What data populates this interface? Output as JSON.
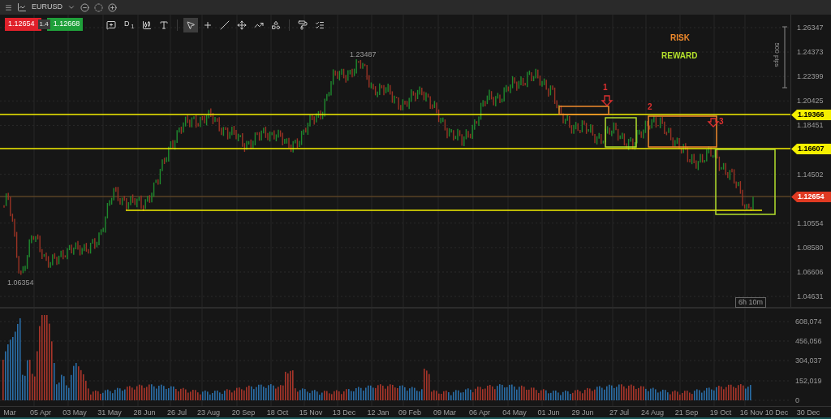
{
  "window": {
    "title": "EURUSD"
  },
  "quote": {
    "bid": "1.12654",
    "spread": "1.4",
    "ask": "1.12668"
  },
  "toolbar": {
    "tools": [
      {
        "kind": "comment",
        "selected": false
      },
      {
        "kind": "timeframe",
        "label": "D",
        "sub": "1",
        "selected": false
      },
      {
        "kind": "bars",
        "selected": false
      },
      {
        "kind": "text",
        "selected": false
      },
      {
        "kind": "pointer",
        "selected": true
      },
      {
        "kind": "crosshair",
        "selected": false
      },
      {
        "kind": "line",
        "selected": false
      },
      {
        "kind": "star",
        "selected": false
      },
      {
        "kind": "polyline",
        "selected": false
      },
      {
        "kind": "shapes",
        "selected": false
      },
      {
        "kind": "paint",
        "selected": false
      },
      {
        "kind": "list",
        "selected": false
      }
    ]
  },
  "legend": [
    {
      "text": "RISK",
      "color": "#f08a2c"
    },
    {
      "text": "REWARD",
      "color": "#b4e02c"
    }
  ],
  "markers": [
    "1",
    "2",
    "3"
  ],
  "high_label": "1.23487",
  "low_label": "1.06354",
  "range_label": "500 pips",
  "countdown": "6h 10m",
  "price_axis": {
    "labels": [
      "1.26347",
      "1.24373",
      "1.22399",
      "1.20425",
      "1.18451",
      "1.14502",
      "1.10554",
      "1.08580",
      "1.06606",
      "1.04631"
    ],
    "price_tags": [
      {
        "text": "1.19366",
        "kind": "line",
        "color": "#f5f000"
      },
      {
        "text": "1.16607",
        "kind": "line",
        "color": "#f5f000"
      },
      {
        "text": "1.12654",
        "kind": "current",
        "color": "#e03a22"
      }
    ]
  },
  "volume_axis": {
    "labels": [
      "608,074",
      "456,056",
      "304,037",
      "152,019",
      "0"
    ]
  },
  "time_axis": {
    "labels": [
      "Mar",
      "05 Apr",
      "03 May",
      "31 May",
      "28 Jun",
      "26 Jul",
      "23 Aug",
      "20 Sep",
      "18 Oct",
      "15 Nov",
      "13 Dec",
      "12 Jan",
      "09 Feb",
      "09 Mar",
      "06 Apr",
      "04 May",
      "01 Jun",
      "29 Jun",
      "27 Jul",
      "24 Aug",
      "21 Sep",
      "19 Oct",
      "16 Nov",
      "10 Dec",
      "30 Dec"
    ]
  }
}
